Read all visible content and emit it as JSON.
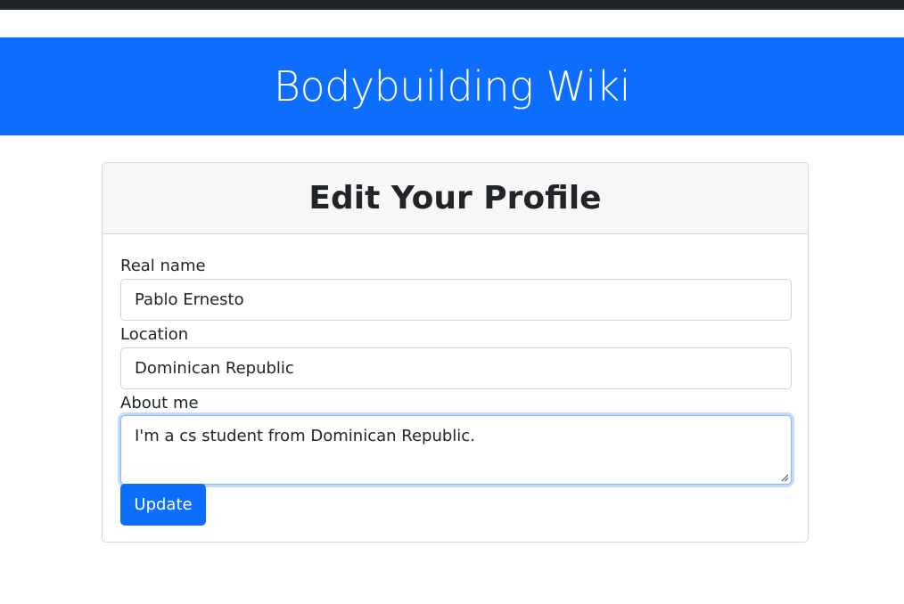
{
  "site": {
    "title": "Bodybuilding Wiki"
  },
  "profile_form": {
    "title": "Edit Your Profile",
    "real_name": {
      "label": "Real name",
      "value": "Pablo Ernesto"
    },
    "location": {
      "label": "Location",
      "value": "Dominican Republic"
    },
    "about_me": {
      "label": "About me",
      "value": "I'm a cs student from Dominican Republic."
    },
    "submit_label": "Update"
  },
  "colors": {
    "primary": "#0d6efd",
    "header_bg": "#f7f7f7",
    "focus_border": "#86b7fe",
    "text": "#212529"
  }
}
